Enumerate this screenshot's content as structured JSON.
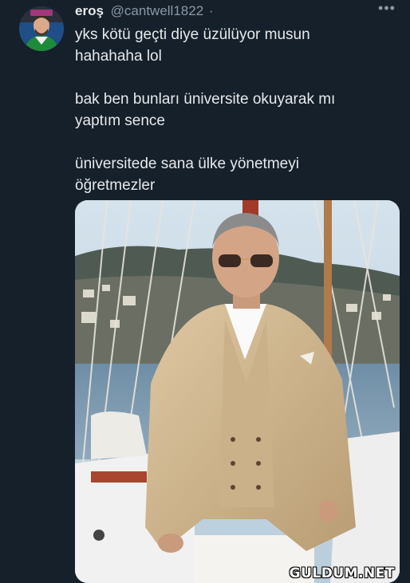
{
  "tweet": {
    "display_name": "eroş",
    "handle": "@cantwell1822",
    "separator": "·",
    "more_icon": "more-dots-icon",
    "paragraphs": [
      {
        "lines": [
          "yks kötü geçti diye üzülüyor musun",
          "hahahaha lol"
        ]
      },
      {
        "lines": [
          "bak ben bunları üniversite okuyarak mı",
          "yaptım sence"
        ]
      },
      {
        "lines": [
          "üniversitede sana ülke yönetmeyi",
          "öğretmezler"
        ]
      }
    ]
  },
  "media": {
    "watermark": "GULDUM.NET"
  },
  "colors": {
    "background": "#15202b",
    "primary_text": "#e7e9ea",
    "secondary_text": "#8b98a5"
  }
}
